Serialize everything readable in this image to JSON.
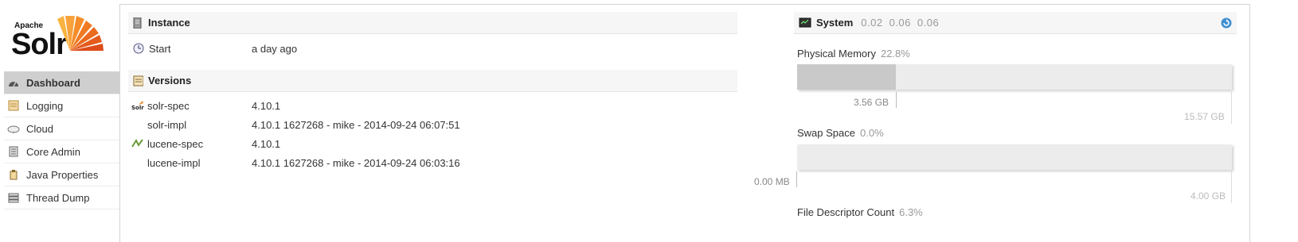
{
  "logo": {
    "apache": "Apache",
    "solr": "Solr"
  },
  "nav": [
    {
      "label": "Dashboard",
      "icon": "dashboard-icon",
      "active": true
    },
    {
      "label": "Logging",
      "icon": "logging-icon"
    },
    {
      "label": "Cloud",
      "icon": "cloud-icon"
    },
    {
      "label": "Core Admin",
      "icon": "core-admin-icon"
    },
    {
      "label": "Java Properties",
      "icon": "java-properties-icon"
    },
    {
      "label": "Thread Dump",
      "icon": "thread-dump-icon"
    }
  ],
  "instance": {
    "title": "Instance",
    "start_label": "Start",
    "start_value": "a day ago"
  },
  "versions": {
    "title": "Versions",
    "rows": [
      {
        "key": "solr-spec",
        "value": "4.10.1"
      },
      {
        "key": "solr-impl",
        "value": "4.10.1 1627268 - mike - 2014-09-24 06:07:51"
      },
      {
        "key": "lucene-spec",
        "value": "4.10.1"
      },
      {
        "key": "lucene-impl",
        "value": "4.10.1 1627268 - mike - 2014-09-24 06:03:16"
      }
    ]
  },
  "system": {
    "title": "System",
    "load": [
      "0.02",
      "0.06",
      "0.06"
    ],
    "physical_memory": {
      "label": "Physical Memory",
      "percent": "22.8%",
      "fraction": 0.228,
      "used": "3.56 GB",
      "total": "15.57 GB"
    },
    "swap_space": {
      "label": "Swap Space",
      "percent": "0.0%",
      "fraction": 0.0,
      "used": "0.00 MB",
      "total": "4.00 GB"
    },
    "file_descriptor": {
      "label": "File Descriptor Count",
      "percent": "6.3%"
    }
  },
  "colors": {
    "active_nav": "#cfcfcf",
    "bar_fill": "#c9c9c9",
    "bar_bg": "#ececec",
    "refresh": "#3f8fd0"
  }
}
